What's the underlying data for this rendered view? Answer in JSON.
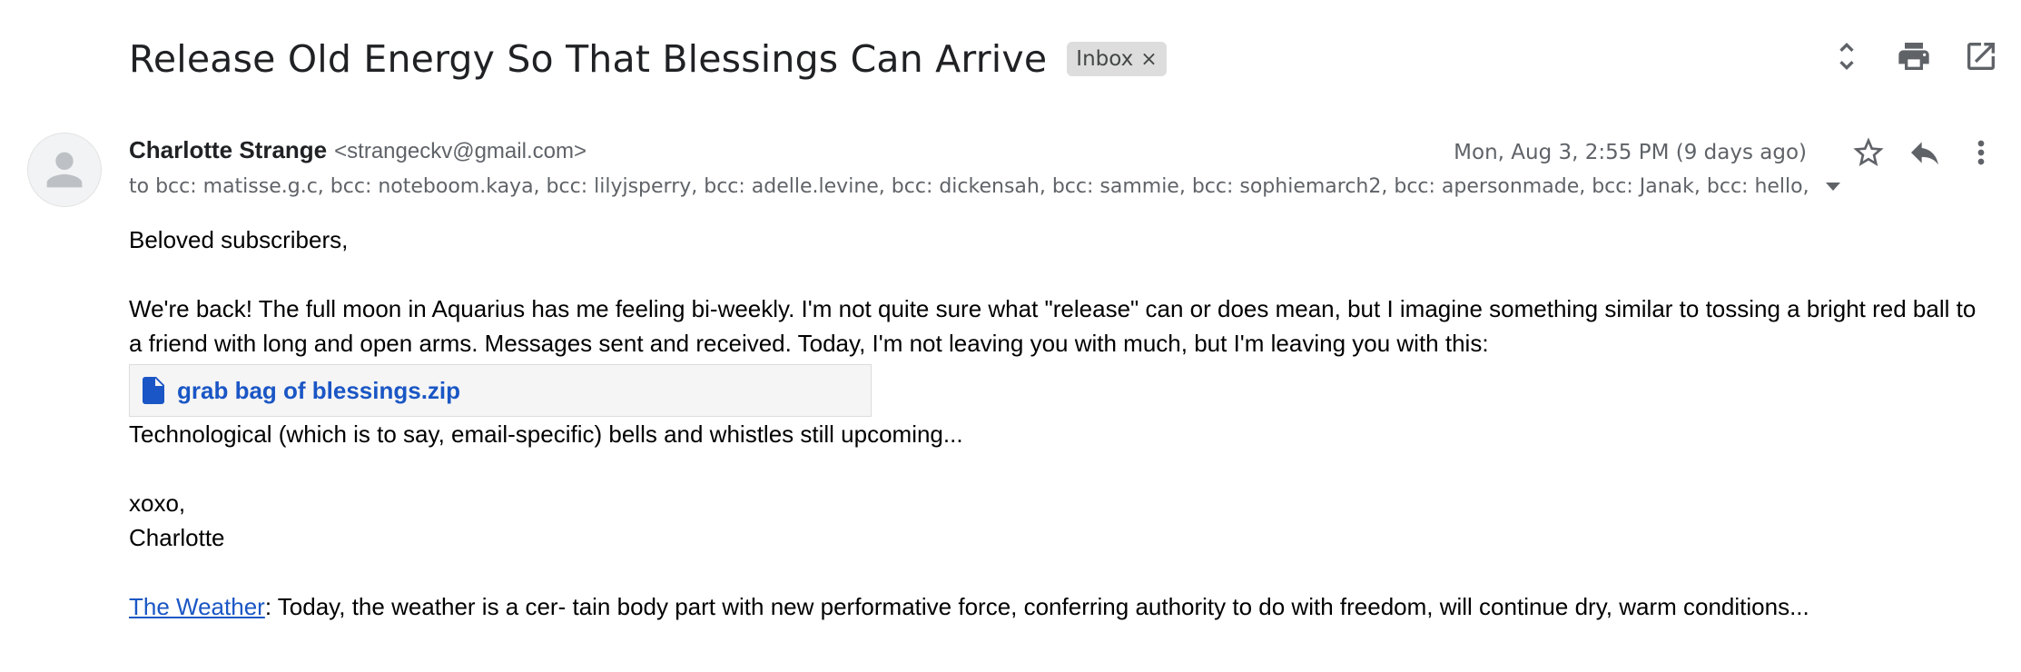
{
  "email": {
    "subject": "Release Old Energy So That Blessings Can Arrive",
    "label": "Inbox",
    "label_remove": "×",
    "sender_name": "Charlotte Strange",
    "sender_email": "<strangeckv@gmail.com>",
    "date": "Mon, Aug 3, 2:55 PM (9 days ago)",
    "recipients": "to bcc: matisse.g.c, bcc: noteboom.kaya, bcc: lilyjsperry, bcc: adelle.levine, bcc: dickensah, bcc: sammie, bcc: sophiemarch2, bcc: apersonmade, bcc: Janak, bcc: hello, b"
  },
  "actions": {
    "top": [
      "expand-collapse-icon",
      "print-icon",
      "open-in-new-window-icon"
    ],
    "message": [
      "star-icon",
      "reply-icon",
      "more-vert-icon"
    ]
  },
  "body": {
    "greeting": "Beloved subscribers,",
    "paragraph1": "We're back! The full moon in Aquarius has me feeling bi-weekly. I'm not quite sure what \"release\" can or does mean, but I imagine something similar to tossing a bright red ball to a friend with long and open arms. Messages sent and received. Today, I'm not leaving you with much, but I'm leaving you with this:",
    "attachment_name": "grab bag of blessings.zip",
    "paragraph2": "Technological (which is to say, email-specific) bells and whistles still upcoming...",
    "signoff": "xoxo,",
    "signature": "Charlotte",
    "weather_link": "The Weather",
    "weather_text": ": Today, the weather is a cer- tain body part with new performative force, conferring authority to do with freedom, will continue dry, warm conditions..."
  },
  "colors": {
    "link": "#1a56c5",
    "icon": "#5f6368",
    "chip_bg": "#dddddd"
  }
}
